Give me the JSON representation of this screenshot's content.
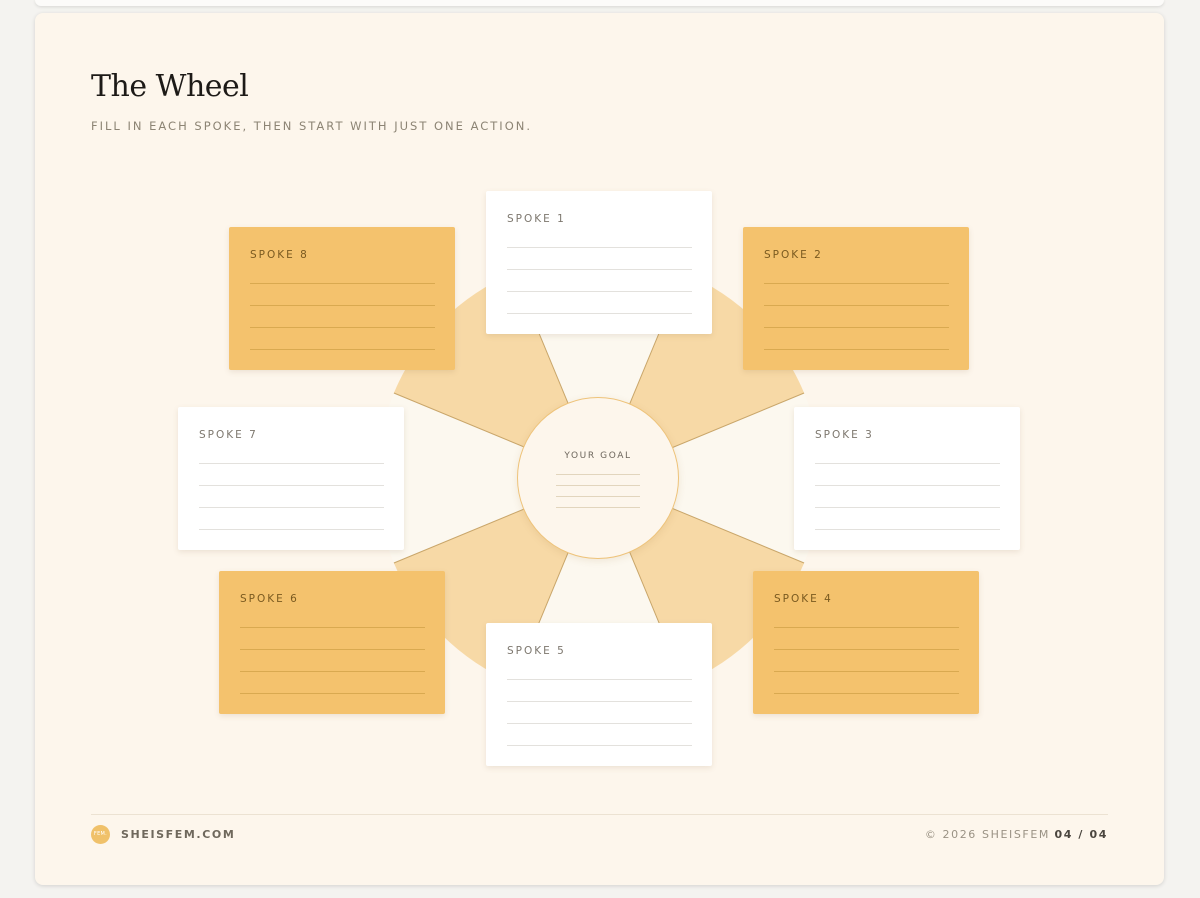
{
  "header": {
    "title": "The Wheel",
    "subtitle": "FILL IN EACH SPOKE, THEN START WITH JUST ONE ACTION."
  },
  "center": {
    "label": "YOUR GOAL"
  },
  "spokes": [
    {
      "label": "SPOKE 1",
      "style": "white"
    },
    {
      "label": "SPOKE 2",
      "style": "amber"
    },
    {
      "label": "SPOKE 3",
      "style": "white"
    },
    {
      "label": "SPOKE 4",
      "style": "amber"
    },
    {
      "label": "SPOKE 5",
      "style": "white"
    },
    {
      "label": "SPOKE 6",
      "style": "amber"
    },
    {
      "label": "SPOKE 7",
      "style": "white"
    },
    {
      "label": "SPOKE 8",
      "style": "amber"
    }
  ],
  "footer": {
    "logo_text": "FEM.",
    "site": "SHEISFEM.COM",
    "copyright": "© 2026 SHEISFEM",
    "page": "04 / 04"
  },
  "colors": {
    "page_bg": "#fdf6ec",
    "amber": "#f4c26d",
    "wheel_light": "#f7d9a6",
    "wheel_pale": "#fcf8ef"
  }
}
